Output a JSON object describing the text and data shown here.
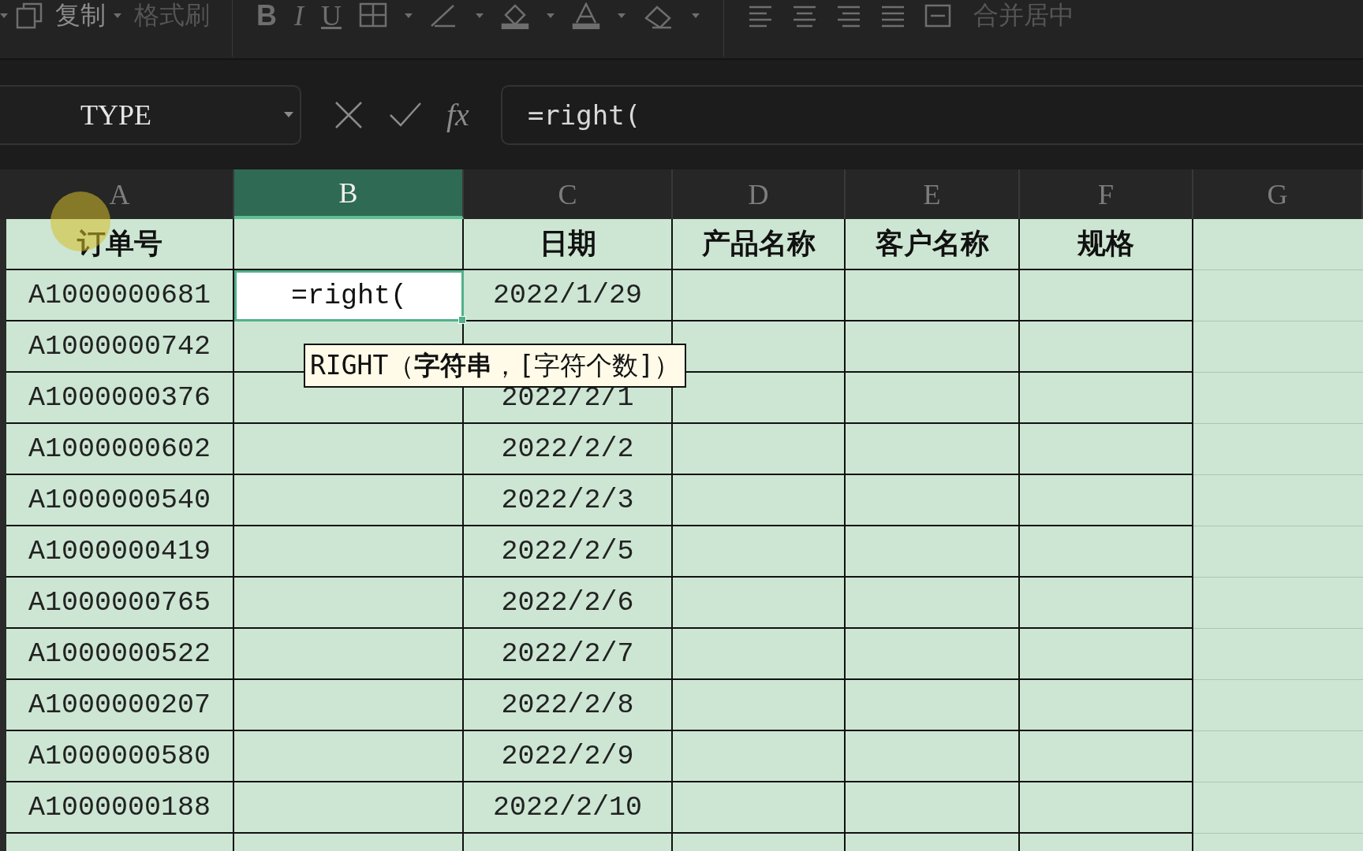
{
  "toolbar": {
    "copy_label": "复制",
    "format_painter": "格式刷",
    "format_buttons": [
      "B",
      "I",
      "U"
    ],
    "merge_label": "合并居中"
  },
  "formula_bar": {
    "name_box": "TYPE",
    "fx": "fx",
    "formula": "=right("
  },
  "columns": [
    {
      "label": "A",
      "selected": false
    },
    {
      "label": "B",
      "selected": true
    },
    {
      "label": "C",
      "selected": false
    },
    {
      "label": "D",
      "selected": false
    },
    {
      "label": "E",
      "selected": false
    },
    {
      "label": "F",
      "selected": false
    },
    {
      "label": "G",
      "selected": false
    }
  ],
  "header_row": {
    "order": "订单号",
    "date": "日期",
    "product": "产品名称",
    "customer": "客户名称",
    "spec": "规格"
  },
  "rows": [
    {
      "order": "A1000000681",
      "entry": "=right(",
      "date": "2022/1/29"
    },
    {
      "order": "A1000000742"
    },
    {
      "order": "A1000000376",
      "date": "2022/2/1"
    },
    {
      "order": "A1000000602",
      "date": "2022/2/2"
    },
    {
      "order": "A1000000540",
      "date": "2022/2/3"
    },
    {
      "order": "A1000000419",
      "date": "2022/2/5"
    },
    {
      "order": "A1000000765",
      "date": "2022/2/6"
    },
    {
      "order": "A1000000522",
      "date": "2022/2/7"
    },
    {
      "order": "A1000000207",
      "date": "2022/2/8"
    },
    {
      "order": "A1000000580",
      "date": "2022/2/9"
    },
    {
      "order": "A1000000188",
      "date": "2022/2/10"
    }
  ],
  "tooltip": "RIGHT（**字符串**，[字符个数]）"
}
